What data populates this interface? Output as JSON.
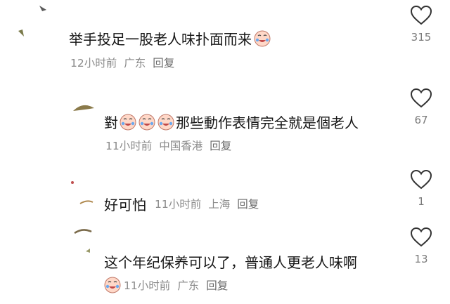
{
  "comments": [
    {
      "name": "",
      "text": "举手投足一股老人味扑面而来",
      "emoji_after": 1,
      "time": "12小时前",
      "location": "广东",
      "reply": "回复",
      "likes": "315"
    },
    {
      "name": "",
      "text_prefix": "對",
      "emoji_mid": 3,
      "text": "那些動作表情完全就是個老人",
      "time": "11小时前",
      "location": "中国香港",
      "reply": "回复",
      "likes": "67"
    },
    {
      "name": "",
      "text": "好可怕",
      "time": "11小时前",
      "location": "上海",
      "reply": "回复",
      "likes": "1"
    },
    {
      "name": "",
      "text": "这个年纪保养可以了，普通人更老人味啊",
      "time": "11小时前",
      "location": "广东",
      "reply": "回复",
      "likes": "13"
    }
  ],
  "icons": {
    "like": "heart-outline-icon",
    "emoji": "crying-laughing-emoji-icon"
  },
  "colors": {
    "text": "#161616",
    "meta": "#8a8a8a",
    "icon": "#333333"
  }
}
